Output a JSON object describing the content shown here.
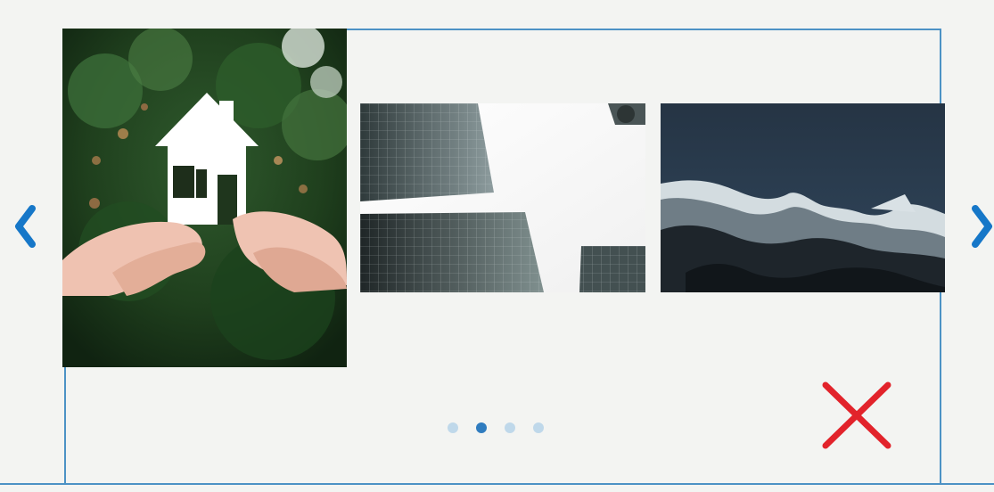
{
  "carousel": {
    "active_index": 2,
    "slide_count": 4,
    "accent_color": "#4c92c5",
    "active_dot_color": "#2f7cbf",
    "inactive_dot_color": "#bfd8ea",
    "close_color": "#e2232b",
    "slides": [
      {
        "subject": "hands-holding-paper-house"
      },
      {
        "subject": "glass-skyscrapers-looking-up"
      },
      {
        "subject": "snowy-mountains-night-sky"
      }
    ],
    "controls": {
      "prev_icon": "chevron-left-icon",
      "next_icon": "chevron-right-icon",
      "close_icon": "close-x-icon"
    }
  }
}
